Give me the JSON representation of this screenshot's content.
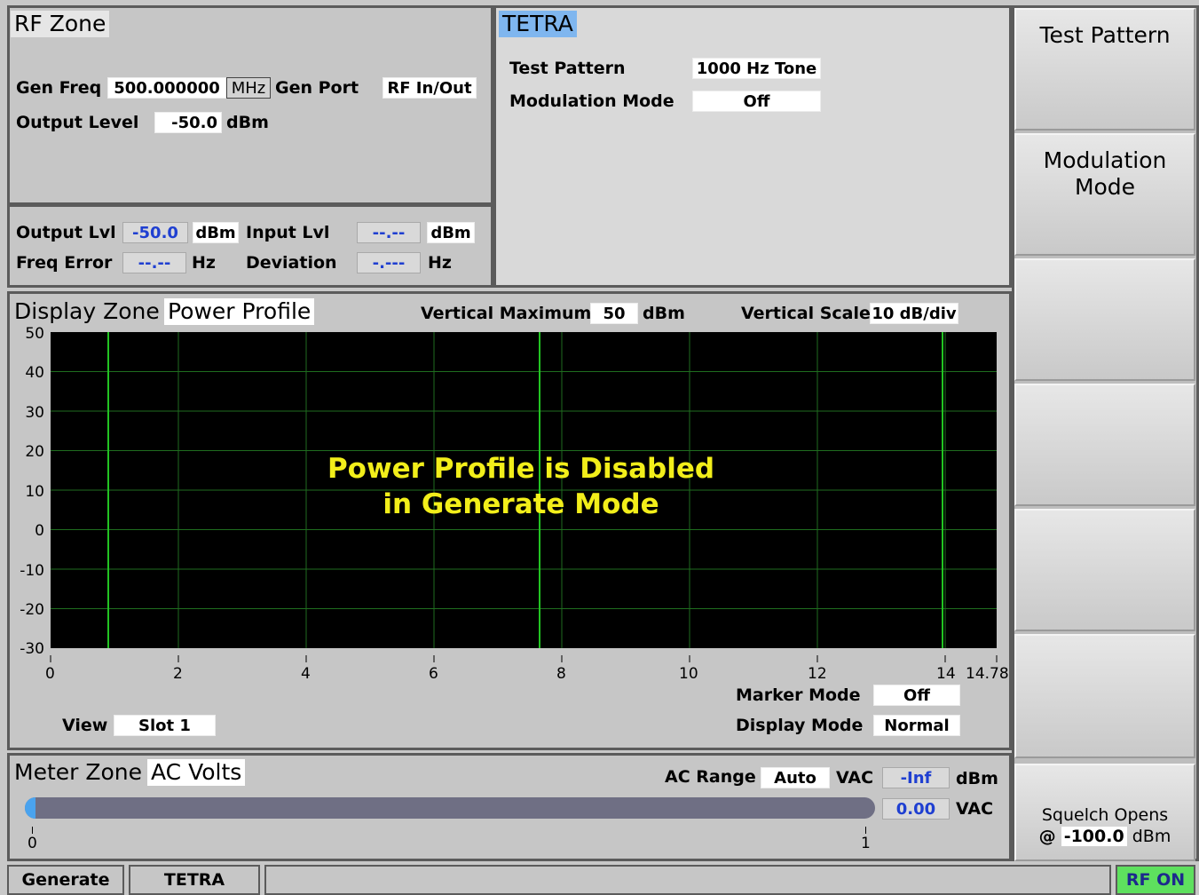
{
  "rf_zone": {
    "title": "RF Zone",
    "gen_freq_label": "Gen Freq",
    "gen_freq_value": "500.000000",
    "gen_freq_unit": "MHz",
    "gen_port_label": "Gen Port",
    "gen_port_value": "RF In/Out",
    "output_level_label": "Output Level",
    "output_level_value": "-50.0",
    "output_level_unit": "dBm",
    "output_lvl_label": "Output Lvl",
    "output_lvl_value": "-50.0",
    "output_lvl_unit": "dBm",
    "input_lvl_label": "Input Lvl",
    "input_lvl_value": "--.--",
    "input_lvl_unit": "dBm",
    "freq_error_label": "Freq Error",
    "freq_error_value": "--.--",
    "freq_error_unit": "Hz",
    "deviation_label": "Deviation",
    "deviation_value": "-.---",
    "deviation_unit": "Hz"
  },
  "tetra_zone": {
    "title": "TETRA",
    "test_pattern_label": "Test Pattern",
    "test_pattern_value": "1000 Hz Tone",
    "modulation_mode_label": "Modulation Mode",
    "modulation_mode_value": "Off"
  },
  "softkeys": {
    "k1": "Test Pattern",
    "k2_line1": "Modulation",
    "k2_line2": "Mode",
    "squelch_line1": "Squelch Opens",
    "squelch_at": "@",
    "squelch_value": "-100.0",
    "squelch_unit": "dBm"
  },
  "display_zone": {
    "title": "Display Zone",
    "mode": "Power Profile",
    "vertical_max_label": "Vertical Maximum",
    "vertical_max_value": "50",
    "vertical_max_unit": "dBm",
    "vertical_scale_label": "Vertical Scale",
    "vertical_scale_value": "10 dB/div",
    "message_line1": "Power Profile is Disabled",
    "message_line2": "in Generate Mode",
    "y_ticks": [
      "50",
      "40",
      "30",
      "20",
      "10",
      "0",
      "-10",
      "-20",
      "-30"
    ],
    "x_ticks": [
      "0",
      "2",
      "4",
      "6",
      "8",
      "10",
      "12",
      "14",
      "14.78"
    ],
    "view_label": "View",
    "view_value": "Slot 1",
    "marker_mode_label": "Marker Mode",
    "marker_mode_value": "Off",
    "display_mode_label": "Display Mode",
    "display_mode_value": "Normal",
    "colors": {
      "grid": "#1f6d1f",
      "marker": "#22c322",
      "message": "#f2ee1a",
      "background": "#000000"
    }
  },
  "meter_zone": {
    "title": "Meter Zone",
    "mode": "AC Volts",
    "ac_range_label": "AC Range",
    "ac_range_value": "Auto",
    "ac_range_unit": "VAC",
    "dbm_value": "-Inf",
    "dbm_unit": "dBm",
    "vac_value": "0.00",
    "vac_unit": "VAC",
    "scale_min": "0",
    "scale_max": "1",
    "level_fraction": 0.0
  },
  "status_bar": {
    "mode": "Generate",
    "system": "TETRA",
    "rf_status": "RF ON"
  }
}
